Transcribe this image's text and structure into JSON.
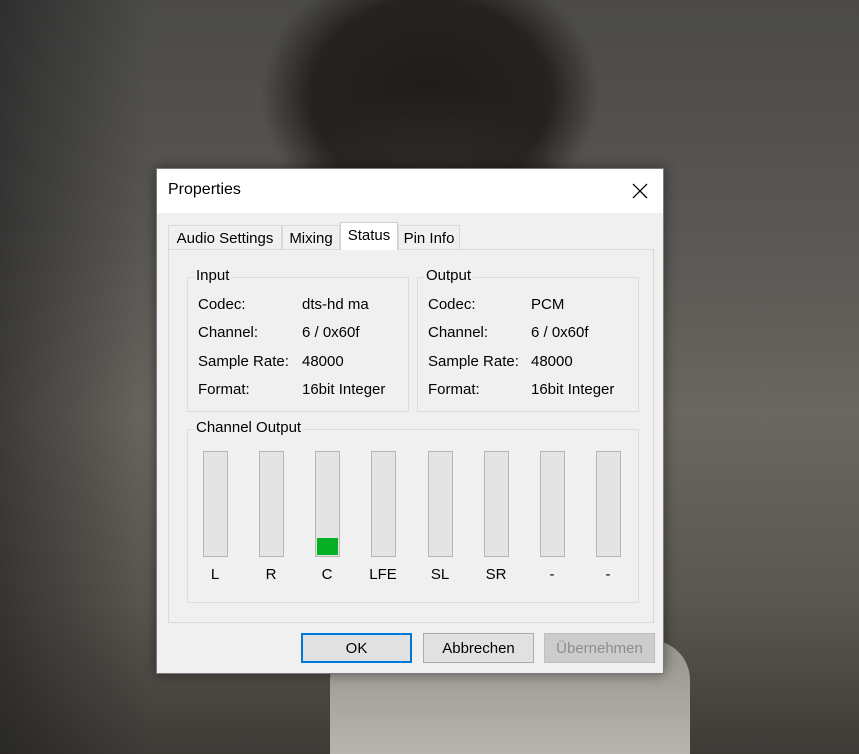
{
  "window": {
    "title": "Properties"
  },
  "tabs": [
    {
      "label": "Audio Settings",
      "active": false
    },
    {
      "label": "Mixing",
      "active": false
    },
    {
      "label": "Status",
      "active": true
    },
    {
      "label": "Pin Info",
      "active": false
    }
  ],
  "input": {
    "heading": "Input",
    "fields": [
      {
        "label": "Codec:",
        "value": "dts-hd ma"
      },
      {
        "label": "Channel:",
        "value": "6 / 0x60f"
      },
      {
        "label": "Sample Rate:",
        "value": "48000"
      },
      {
        "label": "Format:",
        "value": "16bit Integer"
      }
    ]
  },
  "output": {
    "heading": "Output",
    "fields": [
      {
        "label": "Codec:",
        "value": "PCM"
      },
      {
        "label": "Channel:",
        "value": "6 / 0x60f"
      },
      {
        "label": "Sample Rate:",
        "value": "48000"
      },
      {
        "label": "Format:",
        "value": "16bit Integer"
      }
    ]
  },
  "channel_output": {
    "heading": "Channel Output",
    "meter_color": "#06b025",
    "channels": [
      {
        "label": "L",
        "level": 0
      },
      {
        "label": "R",
        "level": 0
      },
      {
        "label": "C",
        "level": 0.17
      },
      {
        "label": "LFE",
        "level": 0
      },
      {
        "label": "SL",
        "level": 0
      },
      {
        "label": "SR",
        "level": 0
      },
      {
        "label": "-",
        "level": 0
      },
      {
        "label": "-",
        "level": 0
      }
    ]
  },
  "buttons": {
    "ok": "OK",
    "cancel": "Abbrechen",
    "apply": "Übernehmen"
  },
  "colors": {
    "accent": "#0078d7",
    "meter": "#06b025"
  }
}
